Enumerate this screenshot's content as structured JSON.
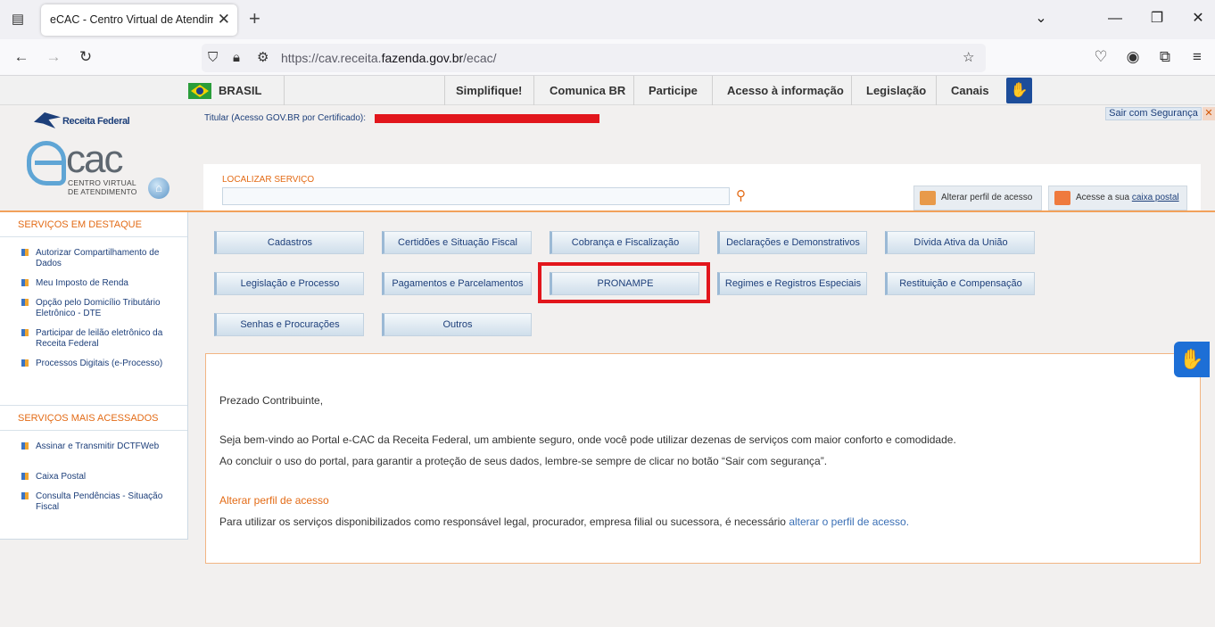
{
  "browser": {
    "tab_title": "eCAC - Centro Virtual de Atendimento",
    "url_prefix": "https://cav.receita.",
    "url_domain": "fazenda.gov.br",
    "url_suffix": "/ecac/"
  },
  "govbar": {
    "country": "BRASIL",
    "links": [
      "Simplifique!",
      "Comunica BR",
      "Participe",
      "Acesso à informação",
      "Legislação",
      "Canais"
    ]
  },
  "header": {
    "brand": "Receita Federal",
    "logo_text": "cac",
    "logo_sub_1": "CENTRO VIRTUAL",
    "logo_sub_2": "DE ATENDIMENTO",
    "titular_label": "Titular (Acesso GOV.BR por Certificado):",
    "logout": "Sair com Segurança",
    "search_label": "LOCALIZAR SERVIÇO",
    "search_value": "",
    "alter_profile": "Alterar perfil de acesso",
    "mailbox_prefix": "Acesse a sua ",
    "mailbox_link": "caixa postal"
  },
  "sidebar": {
    "featured_title": "SERVIÇOS EM DESTAQUE",
    "featured": [
      "Autorizar Compartilhamento de Dados",
      "Meu Imposto de Renda",
      "Opção pelo Domicílio Tributário Eletrônico - DTE",
      "Participar de leilão eletrônico da Receita Federal",
      "Processos Digitais (e-Processo)"
    ],
    "most_accessed_title": "SERVIÇOS MAIS ACESSADOS",
    "most_accessed": [
      "Assinar e Transmitir DCTFWeb",
      "Caixa Postal",
      "Consulta Pendências - Situação Fiscal"
    ]
  },
  "services": [
    "Cadastros",
    "Certidões e Situação Fiscal",
    "Cobrança e Fiscalização",
    "Declarações e Demonstrativos",
    "Dívida Ativa da União",
    "Legislação e Processo",
    "Pagamentos e Parcelamentos",
    "PRONAMPE",
    "Regimes e Registros Especiais",
    "Restituição e Compensação",
    "Senhas e Procurações",
    "Outros"
  ],
  "content": {
    "greeting": "Prezado Contribuinte,",
    "welcome": "Seja bem-vindo ao Portal e-CAC da Receita Federal, um ambiente seguro, onde você pode utilizar dezenas de serviços com maior conforto e comodidade.",
    "reminder": "Ao concluir o uso do portal, para garantir a proteção de seus dados, lembre-se sempre de clicar no botão “Sair com segurança”.",
    "profile_title": "Alterar perfil de acesso",
    "profile_text": "Para utilizar os serviços disponibilizados como responsável legal, procurador, empresa filial ou sucessora, é necessário ",
    "profile_link": "alterar o perfil de acesso."
  },
  "colors": {
    "accent_orange": "#e36b16",
    "navy": "#1d3f7a",
    "highlight_red": "#e2161c"
  }
}
